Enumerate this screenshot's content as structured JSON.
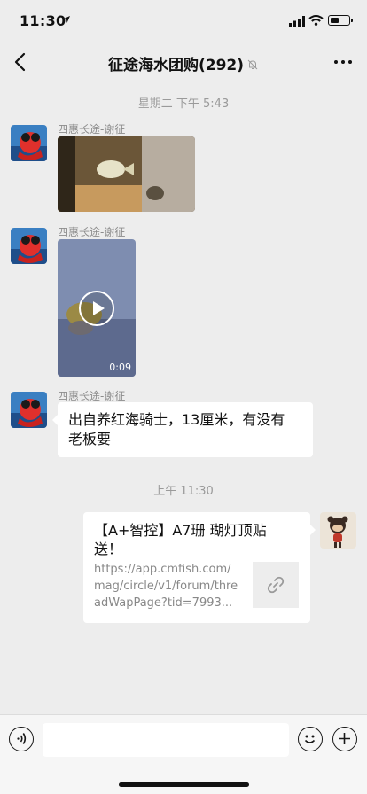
{
  "status_bar": {
    "time": "11:30"
  },
  "header": {
    "title": "征途海水团购(292)",
    "muted": true
  },
  "messages": [
    {
      "type": "timestamp",
      "text": "星期二 下午 5:43"
    },
    {
      "type": "image",
      "side": "left",
      "sender": "四惠长途-谢征"
    },
    {
      "type": "video",
      "side": "left",
      "sender": "四惠长途-谢征",
      "duration": "0:09"
    },
    {
      "type": "text",
      "side": "left",
      "sender": "四惠长途-谢征",
      "lines": [
        "出自养红海骑士，13厘米，有没有",
        "老板要"
      ]
    },
    {
      "type": "timestamp",
      "text": "上午 11:30"
    },
    {
      "type": "link",
      "side": "right",
      "title_lines": [
        "【A+智控】A7珊 瑚灯顶贴",
        "送！"
      ],
      "url_lines": [
        "https://app.cmfish.com/",
        "mag/circle/v1/forum/thre",
        "adWapPage?tid=7993..."
      ]
    }
  ],
  "input_bar": {
    "placeholder": ""
  },
  "icons": [
    "location-arrow-icon",
    "signal-icon",
    "wifi-icon",
    "battery-icon",
    "back-icon",
    "mute-bell-icon",
    "more-icon",
    "play-icon",
    "link-icon",
    "voice-icon",
    "emoji-icon",
    "plus-icon"
  ]
}
